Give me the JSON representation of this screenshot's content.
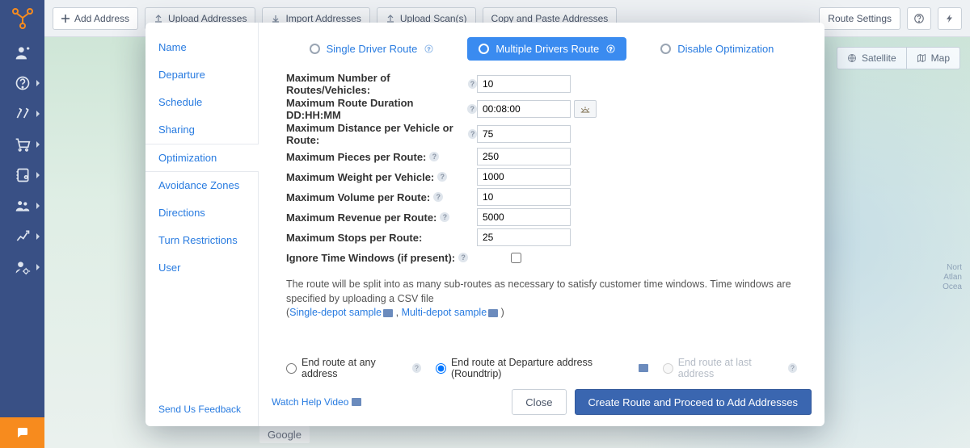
{
  "toolbar": {
    "add_address": "Add Address",
    "upload_addresses": "Upload Addresses",
    "import_addresses": "Import Addresses",
    "upload_scans": "Upload Scan(s)",
    "copy_paste": "Copy and Paste Addresses",
    "route_settings": "Route Settings"
  },
  "map": {
    "satellite": "Satellite",
    "map": "Map",
    "ocean_label": "Nort\nAtlan\nOcea",
    "google": "Google"
  },
  "modal": {
    "nav": {
      "name": "Name",
      "departure": "Departure",
      "schedule": "Schedule",
      "sharing": "Sharing",
      "optimization": "Optimization",
      "avoidance": "Avoidance Zones",
      "directions": "Directions",
      "turn": "Turn Restrictions",
      "user": "User"
    },
    "feedback": "Send Us Feedback",
    "opt_tabs": {
      "single": "Single Driver Route",
      "multiple": "Multiple Drivers Route",
      "disable": "Disable Optimization"
    },
    "fields": {
      "max_routes_label": "Maximum Number of Routes/Vehicles:",
      "max_routes_value": "10",
      "max_duration_label": "Maximum Route Duration DD:HH:MM",
      "max_duration_value": "00:08:00",
      "max_distance_label": "Maximum Distance per Vehicle or Route:",
      "max_distance_value": "75",
      "max_pieces_label": "Maximum Pieces per Route:",
      "max_pieces_value": "250",
      "max_weight_label": "Maximum Weight per Vehicle:",
      "max_weight_value": "1000",
      "max_volume_label": "Maximum Volume per Route:",
      "max_volume_value": "10",
      "max_revenue_label": "Maximum Revenue per Route:",
      "max_revenue_value": "5000",
      "max_stops_label": "Maximum Stops per Route:",
      "max_stops_value": "25",
      "ignore_tw_label": "Ignore Time Windows (if present):"
    },
    "note_text": "The route will be split into as many sub-routes as necessary to satisfy customer time windows. Time windows are specified by uploading a CSV file",
    "note_link1": "Single-depot sample",
    "note_sep": " , ",
    "note_link2": "Multi-depot sample",
    "endroute": {
      "any": "End route at any address",
      "roundtrip": "End route at Departure address (Roundtrip)",
      "last": "End route at last address"
    },
    "footer": {
      "watch": "Watch Help Video",
      "close": "Close",
      "primary": "Create Route and Proceed to Add Addresses"
    }
  }
}
